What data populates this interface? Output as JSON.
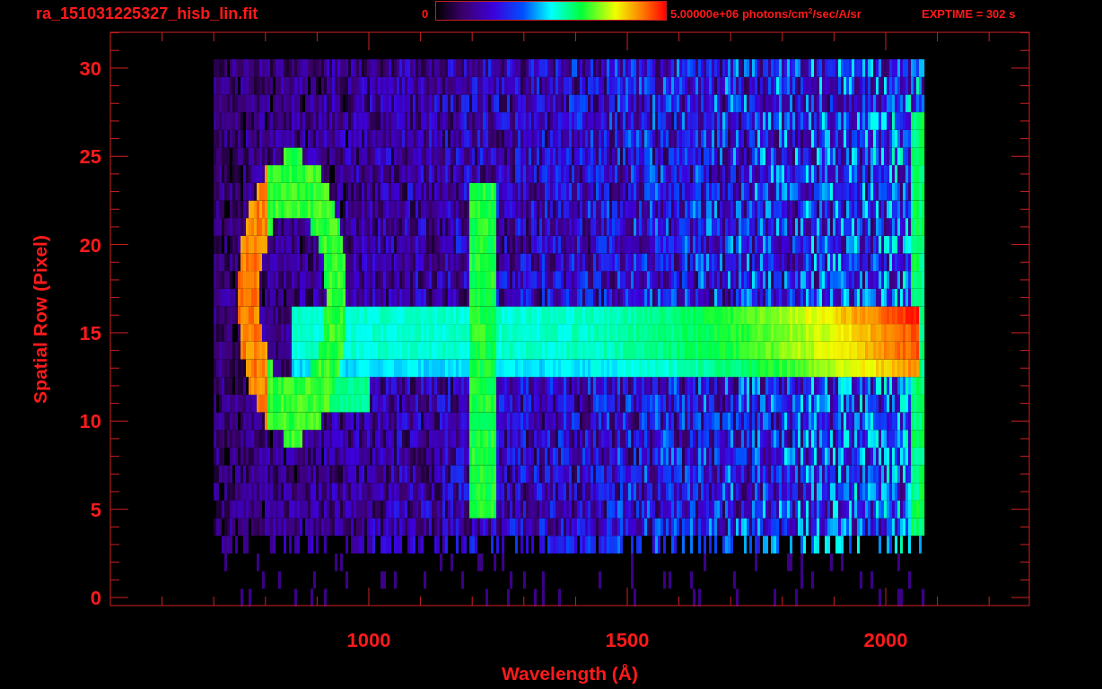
{
  "header": {
    "title": "ra_151031225327_hisb_lin.fit",
    "colorbar": {
      "min_label": "0",
      "max_label": "5.00000e+06 photons/cm$^{2}$/sec/A/sr"
    },
    "exposure": "EXPTIME = 302 s"
  },
  "plot": {
    "x_axis": {
      "label": "Wavelength (Å)",
      "ticks": [
        "1000",
        "1500",
        "2000"
      ]
    },
    "y_axis": {
      "label": "Spatial Row (Pixel)",
      "ticks": [
        "30",
        "25",
        "20",
        "15",
        "10",
        "5",
        "0"
      ]
    }
  }
}
